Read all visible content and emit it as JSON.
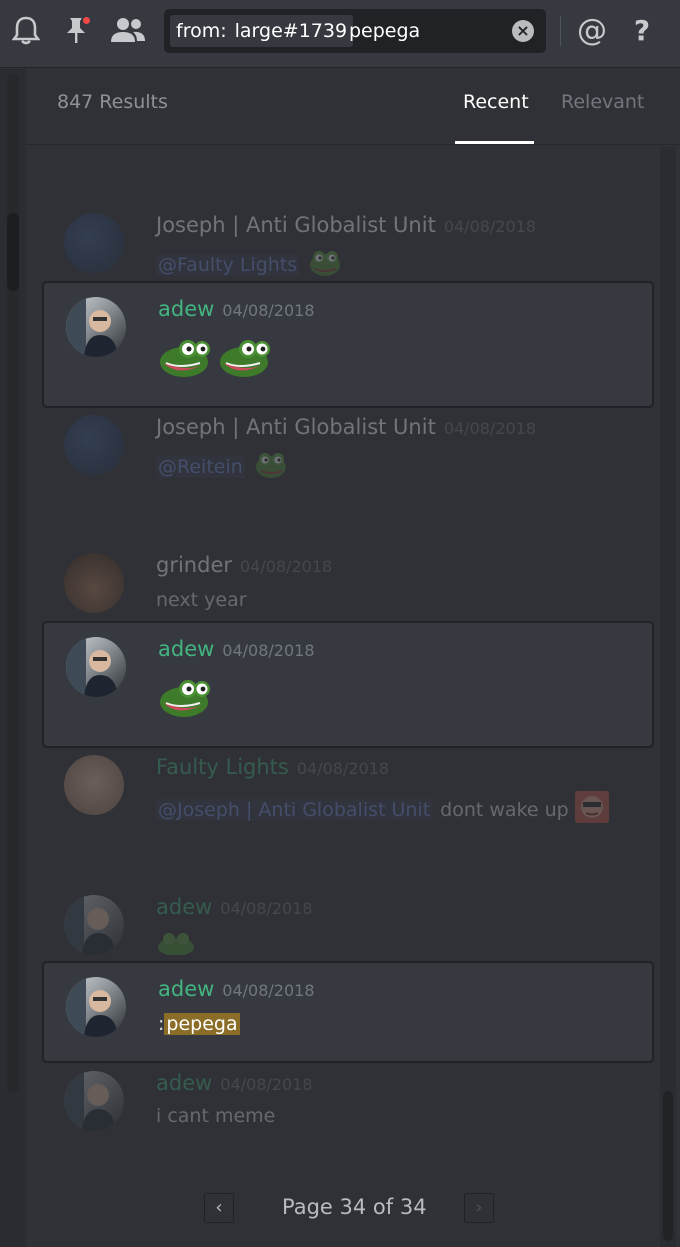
{
  "toolbar": {
    "icons": [
      "bell-icon",
      "pin-icon",
      "members-icon",
      "mention-icon",
      "help-icon"
    ],
    "search": {
      "filter_key": "from:",
      "filter_value": "large#1739",
      "query": "pepega",
      "clear_icon": "close-icon"
    },
    "mention_glyph": "@",
    "help_glyph": "?"
  },
  "results": {
    "count_label": "847 Results",
    "tabs": {
      "recent": "Recent",
      "relevant": "Relevant"
    },
    "active_tab": "Recent"
  },
  "colors": {
    "adew": "#43b581",
    "faulty": "#43b581",
    "default_name": "#ffffff",
    "mention": "#7289da",
    "highlight": "#8a6d26",
    "background": "#2f3136"
  },
  "messages": [
    {
      "author": "Joseph | Anti Globalist Unit",
      "timestamp": "04/08/2018",
      "mention": "@Faulty Lights",
      "text": "",
      "emojis": [
        "pepe-smug-emoji"
      ],
      "highlighted": false
    },
    {
      "author": "adew",
      "timestamp": "04/08/2018",
      "mention": "",
      "text": "",
      "emojis": [
        "pepega-emoji",
        "pepega-emoji"
      ],
      "highlighted": true
    },
    {
      "author": "Joseph | Anti Globalist Unit",
      "timestamp": "04/08/2018",
      "mention": "@Reitein",
      "text": "",
      "emojis": [
        "pepe-smug-emoji"
      ],
      "highlighted": false
    },
    {
      "author": "grinder",
      "timestamp": "04/08/2018",
      "mention": "",
      "text": "next year",
      "emojis": [],
      "highlighted": false
    },
    {
      "author": "adew",
      "timestamp": "04/08/2018",
      "mention": "",
      "text": "",
      "emojis": [
        "pepega-emoji"
      ],
      "highlighted": true
    },
    {
      "author": "Faulty Lights",
      "timestamp": "04/08/2018",
      "mention": "@Joseph | Anti Globalist Unit",
      "text": "dont wake up",
      "emojis": [
        "face-emoji"
      ],
      "highlighted": false
    },
    {
      "author": "adew",
      "timestamp": "04/08/2018",
      "mention": "",
      "text": "",
      "emojis": [
        "pepe-emoji"
      ],
      "highlighted": false
    },
    {
      "author": "adew",
      "timestamp": "04/08/2018",
      "mention": "",
      "text_prefix": ":",
      "text_highlight": "pepega",
      "emojis": [],
      "highlighted": true
    },
    {
      "author": "adew",
      "timestamp": "04/08/2018",
      "mention": "",
      "text": "i cant meme",
      "emojis": [],
      "highlighted": false
    }
  ],
  "pagination": {
    "label": "Page 34 of 34",
    "prev_icon": "chevron-left-icon",
    "next_icon": "chevron-right-icon",
    "prev_glyph": "‹",
    "next_glyph": "›"
  }
}
